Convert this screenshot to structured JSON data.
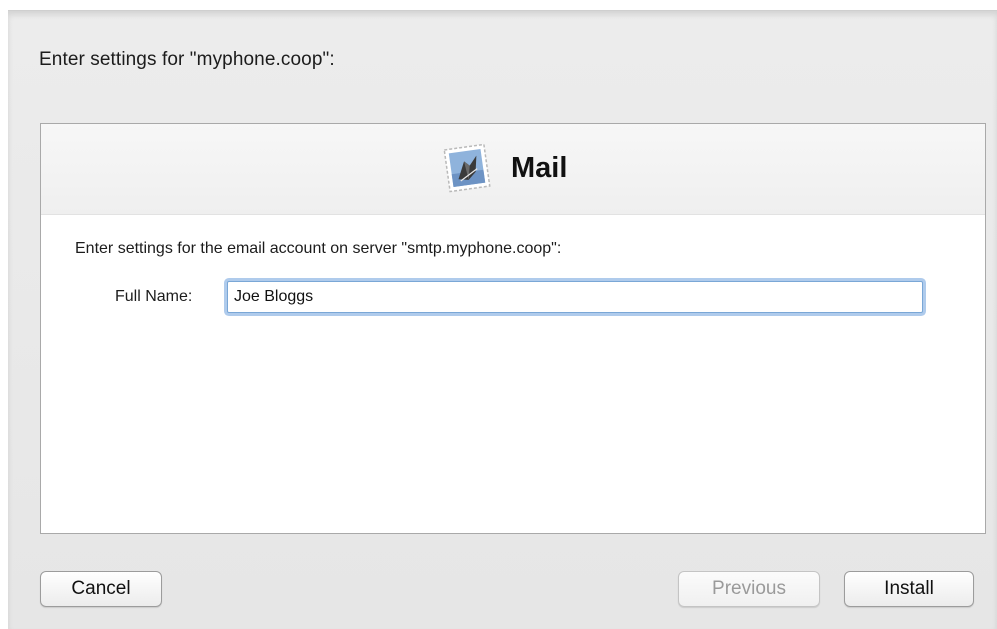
{
  "dialog": {
    "prompt": "Enter settings for \"myphone.coop\":"
  },
  "panel": {
    "app_icon": "mail-stamp-icon",
    "app_title": "Mail",
    "instructions": "Enter settings for the email account on server \"smtp.myphone.coop\":",
    "fields": [
      {
        "label": "Full Name:",
        "value": "Joe Bloggs"
      }
    ]
  },
  "buttons": {
    "cancel": "Cancel",
    "previous": "Previous",
    "install": "Install"
  }
}
